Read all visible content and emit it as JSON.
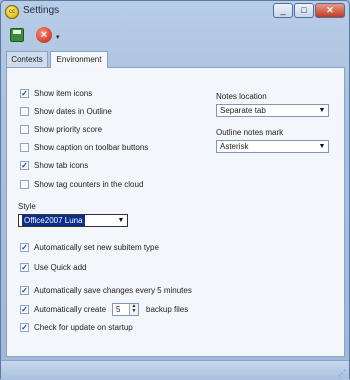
{
  "window": {
    "title": "Settings",
    "app_icon_text": "cc"
  },
  "titlebar": {
    "minimize": "_",
    "maximize": "□",
    "close": "✕"
  },
  "toolbar": {
    "more": "▾"
  },
  "tabs": [
    {
      "label": "Contexts"
    },
    {
      "label": "Environment",
      "active": true
    }
  ],
  "checks": [
    {
      "label": "Show item icons",
      "checked": true
    },
    {
      "label": "Show dates in Outline",
      "checked": false
    },
    {
      "label": "Show priority score",
      "checked": false
    },
    {
      "label": "Show caption on toolbar buttons",
      "checked": false
    },
    {
      "label": "Show tab icons",
      "checked": true
    },
    {
      "label": "Show tag counters in the cloud",
      "checked": false
    }
  ],
  "notes_location": {
    "label": "Notes location",
    "value": "Separate tab"
  },
  "outline_mark": {
    "label": "Outline notes mark",
    "value": "Asterisk"
  },
  "style": {
    "label": "Style",
    "value": "Office2007 Luna"
  },
  "checks2": [
    {
      "label": "Automatically set new subitem type",
      "checked": true
    },
    {
      "label": "Use Quick add",
      "checked": true
    },
    {
      "label": "Automatically save changes every 5 minutes",
      "checked": true
    },
    {
      "label": "Automatically create",
      "checked": true
    },
    {
      "label": "Check for update on startup",
      "checked": true
    }
  ],
  "backup": {
    "value": "5",
    "suffix": "backup files"
  },
  "check_mark": "✓",
  "dropdown_glyph": "▼"
}
